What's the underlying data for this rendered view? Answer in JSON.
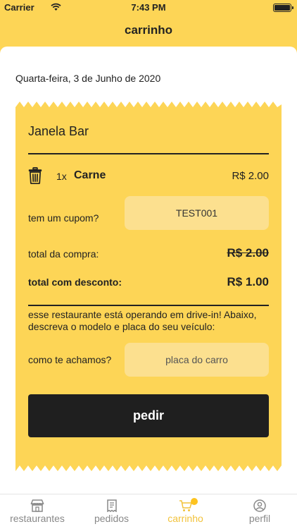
{
  "status_bar": {
    "carrier": "Carrier",
    "time": "7:43 PM"
  },
  "nav": {
    "title": "carrinho"
  },
  "date": "Quarta-feira, 3 de Junho de 2020",
  "receipt": {
    "shop_name": "Janela Bar",
    "items": [
      {
        "qty": "1x",
        "name": "Carne",
        "price": "R$ 2.00"
      }
    ],
    "coupon": {
      "label": "tem um cupom?",
      "value": "TEST001"
    },
    "total": {
      "label": "total da compra:",
      "value": "R$ 2.00"
    },
    "discount_total": {
      "label": "total com desconto:",
      "value": "R$ 1.00"
    },
    "notice": "esse restaurante está operando em drive-in! Abaixo, descreva o modelo e placa do seu veículo:",
    "car": {
      "label": "como te achamos?",
      "placeholder": "placa do carro"
    },
    "order_button": "pedir"
  },
  "tabs": [
    {
      "label": "restaurantes",
      "icon": "store-icon",
      "active": false
    },
    {
      "label": "pedidos",
      "icon": "receipt-icon",
      "active": false
    },
    {
      "label": "carrinho",
      "icon": "cart-icon",
      "active": true
    },
    {
      "label": "perfil",
      "icon": "user-icon",
      "active": false
    }
  ],
  "colors": {
    "primary": "#fdd556",
    "field": "#fce08f",
    "active_tab": "#f2c23a",
    "button": "#1f1f1f"
  }
}
